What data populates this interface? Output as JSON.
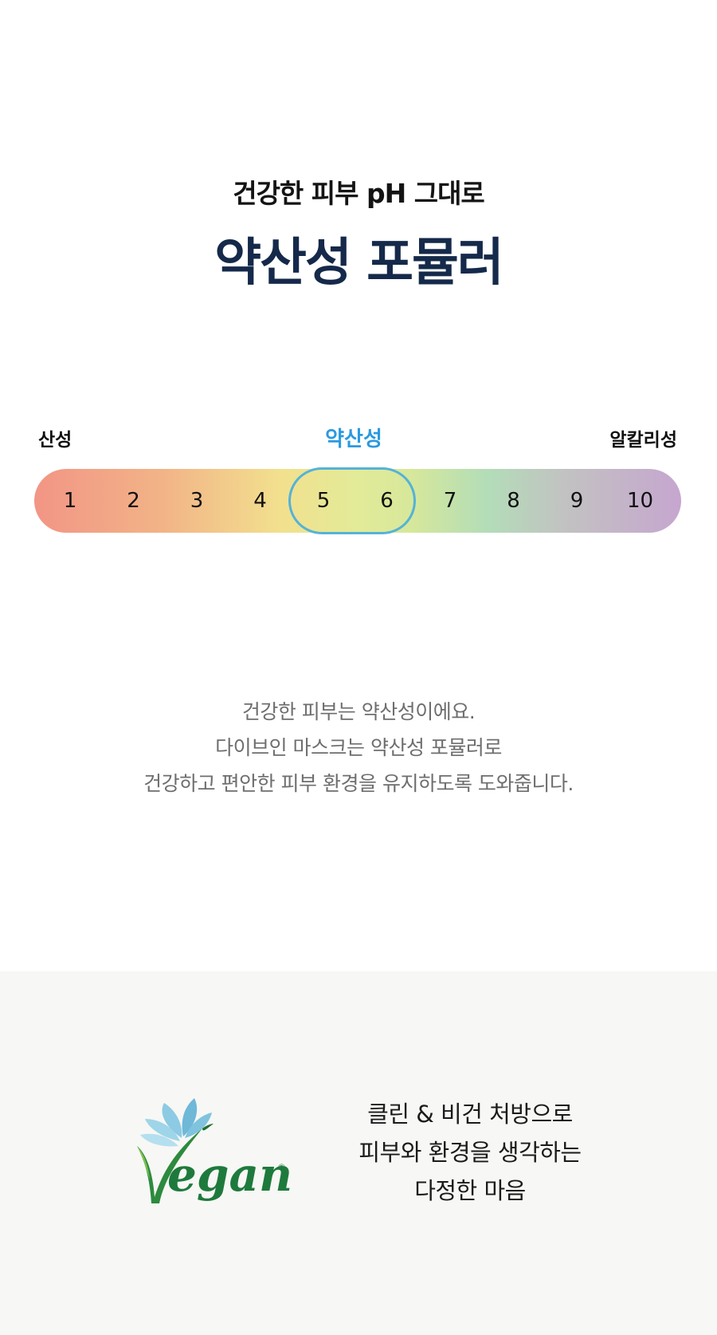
{
  "header": {
    "subtitle": "건강한 피부 pH 그대로",
    "title": "약산성 포뮬러"
  },
  "ph_scale": {
    "label_left": "산성",
    "label_center": "약산성",
    "label_right": "알칼리성",
    "numbers": [
      "1",
      "2",
      "3",
      "4",
      "5",
      "6",
      "7",
      "8",
      "9",
      "10"
    ],
    "highlighted_range": [
      5,
      6
    ],
    "colors": {
      "acid": "#f29585",
      "neutral": "#e2eb98",
      "alkaline": "#c6a6cf",
      "highlight_border": "#55b2d8",
      "center_label": "#2a9ae0"
    }
  },
  "description": {
    "line1": "건강한 피부는 약산성이에요.",
    "line2": "다이브인 마스크는 약산성 포뮬러로",
    "line3": "건강하고 편안한 피부 환경을 유지하도록 도와줍니다."
  },
  "vegan": {
    "logo_icon": "vegan-logo-icon",
    "logo_text": "Vegan",
    "line1": "클린 & 비건 처방으로",
    "line2": "피부와 환경을 생각하는",
    "line3": "다정한 마음"
  }
}
